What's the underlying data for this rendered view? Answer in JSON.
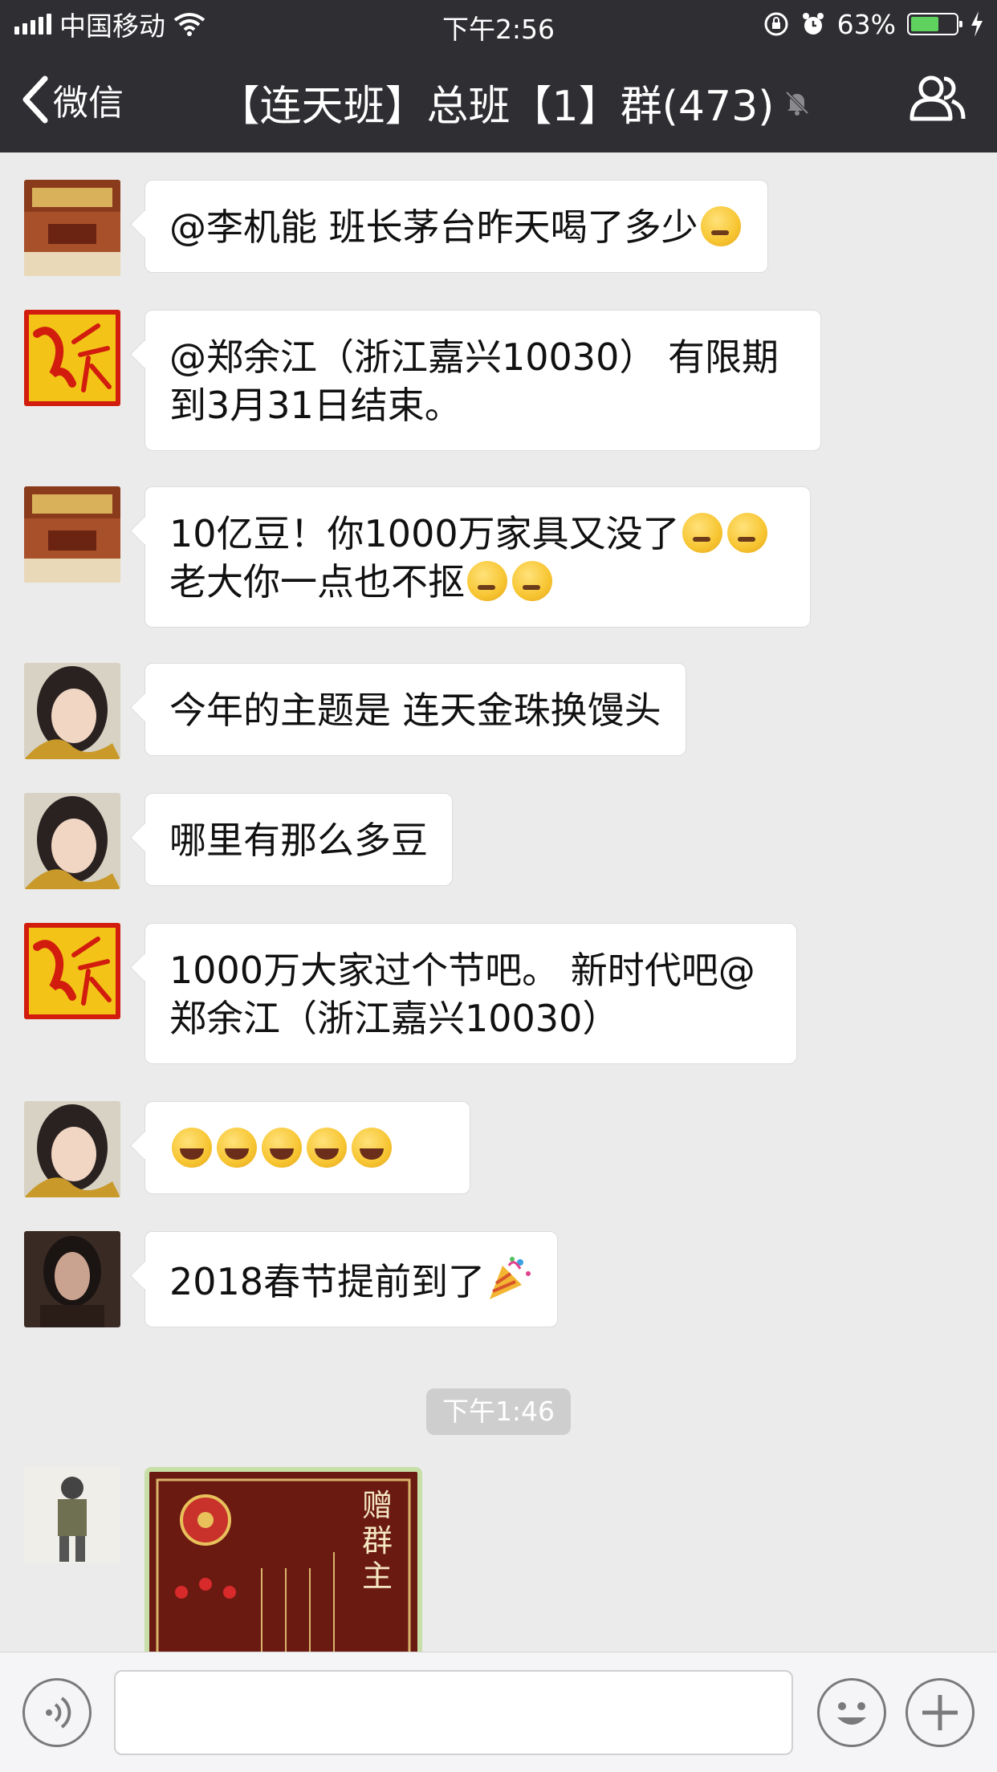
{
  "status_bar": {
    "carrier": "中国移动",
    "time": "下午2:56",
    "battery": "63%"
  },
  "nav": {
    "back_label": "微信",
    "title": "【连天班】总班【1】群(473)"
  },
  "messages": [
    {
      "text": "@李机能 班长茅台昨天喝了多少",
      "avatar": "furniture-room"
    },
    {
      "text": "@郑余江（浙江嘉兴10030） 有限期到3月31日结束。",
      "avatar": "red-logo"
    },
    {
      "line1": "10亿豆！你1000万家具又没了",
      "line2": "老大你一点也不抠",
      "avatar": "furniture-room"
    },
    {
      "text": "今年的主题是 连天金珠换馒头",
      "avatar": "woman-selfie"
    },
    {
      "text": "哪里有那么多豆",
      "avatar": "woman-selfie"
    },
    {
      "text": "1000万大家过个节吧。 新时代吧@郑余江（浙江嘉兴10030）",
      "avatar": "red-logo"
    },
    {
      "text": "",
      "avatar": "woman-selfie"
    },
    {
      "text": "2018春节提前到了",
      "avatar": "woman-dark"
    }
  ],
  "timestamp": "下午1:46",
  "image_message": {
    "caption": "赠群主"
  },
  "colors": {
    "nav_bg": "#2e2e33",
    "chat_bg": "#ebebeb",
    "bubble": "#ffffff",
    "battery": "#5fd15f"
  }
}
